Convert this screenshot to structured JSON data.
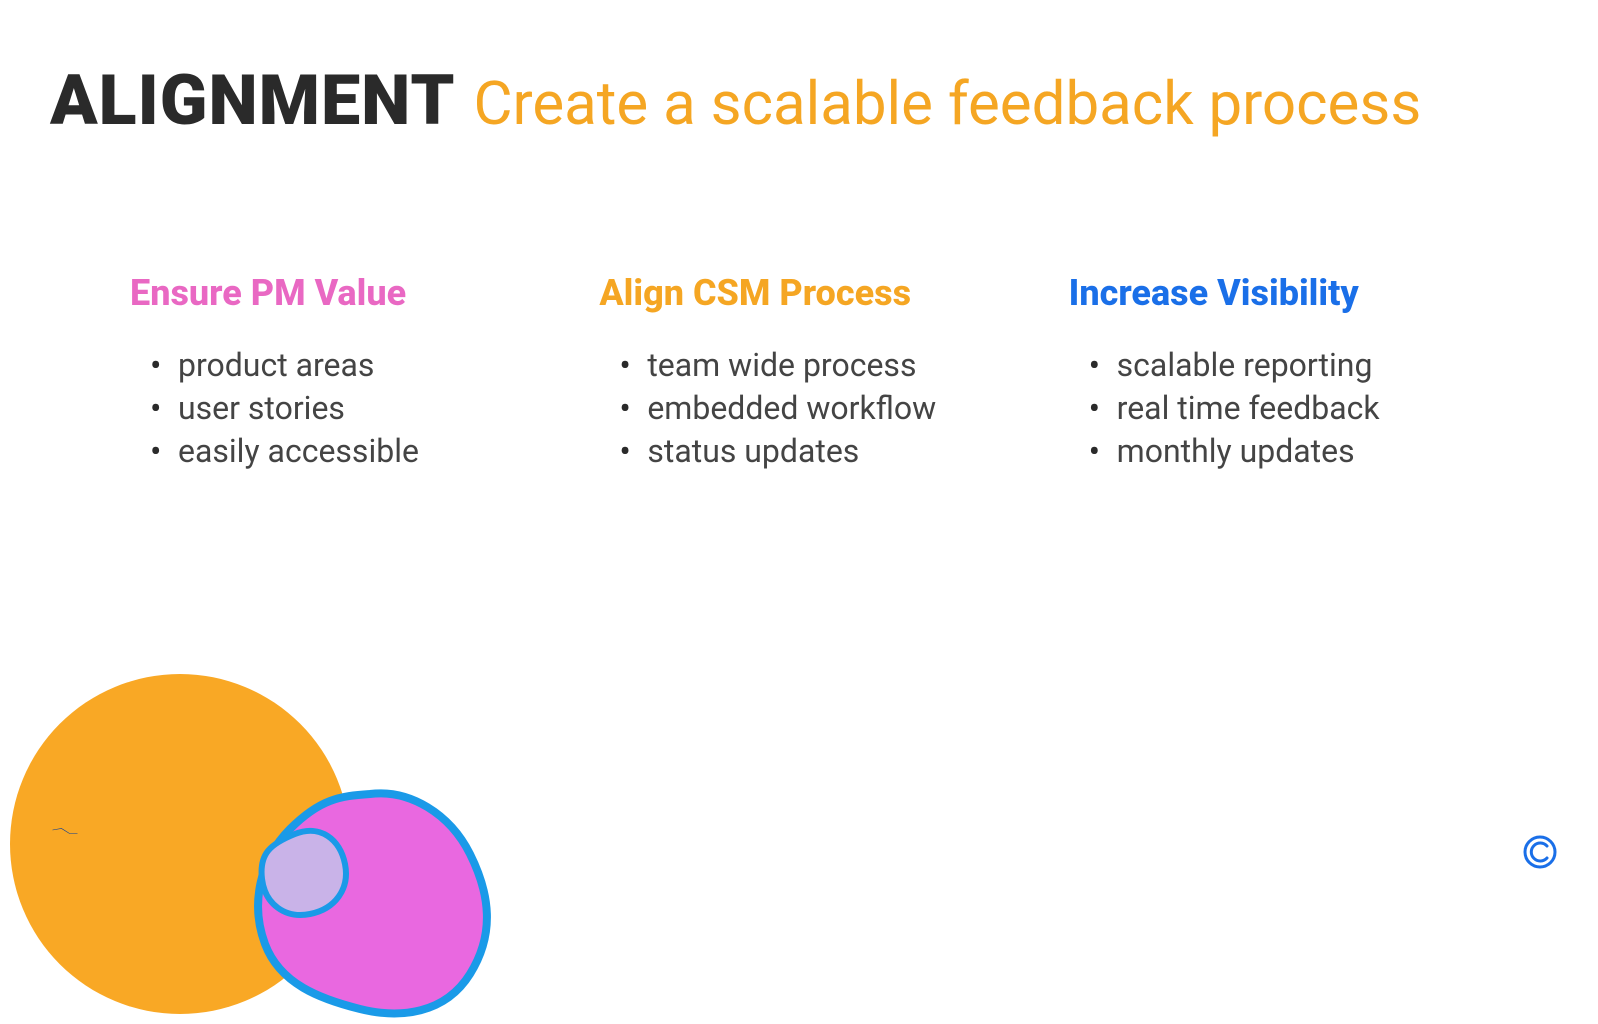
{
  "header": {
    "title": "ALIGNMENT",
    "subtitle": "Create a scalable feedback process"
  },
  "columns": [
    {
      "heading": "Ensure PM Value",
      "colorClass": "pink",
      "items": [
        "product areas",
        "user stories",
        "easily accessible"
      ]
    },
    {
      "heading": "Align CSM Process",
      "colorClass": "orange",
      "items": [
        "team wide process",
        "embedded workflow",
        "status updates"
      ]
    },
    {
      "heading": "Increase Visibility",
      "colorClass": "blue",
      "items": [
        "scalable reporting",
        "real time feedback",
        "monthly updates"
      ]
    }
  ]
}
